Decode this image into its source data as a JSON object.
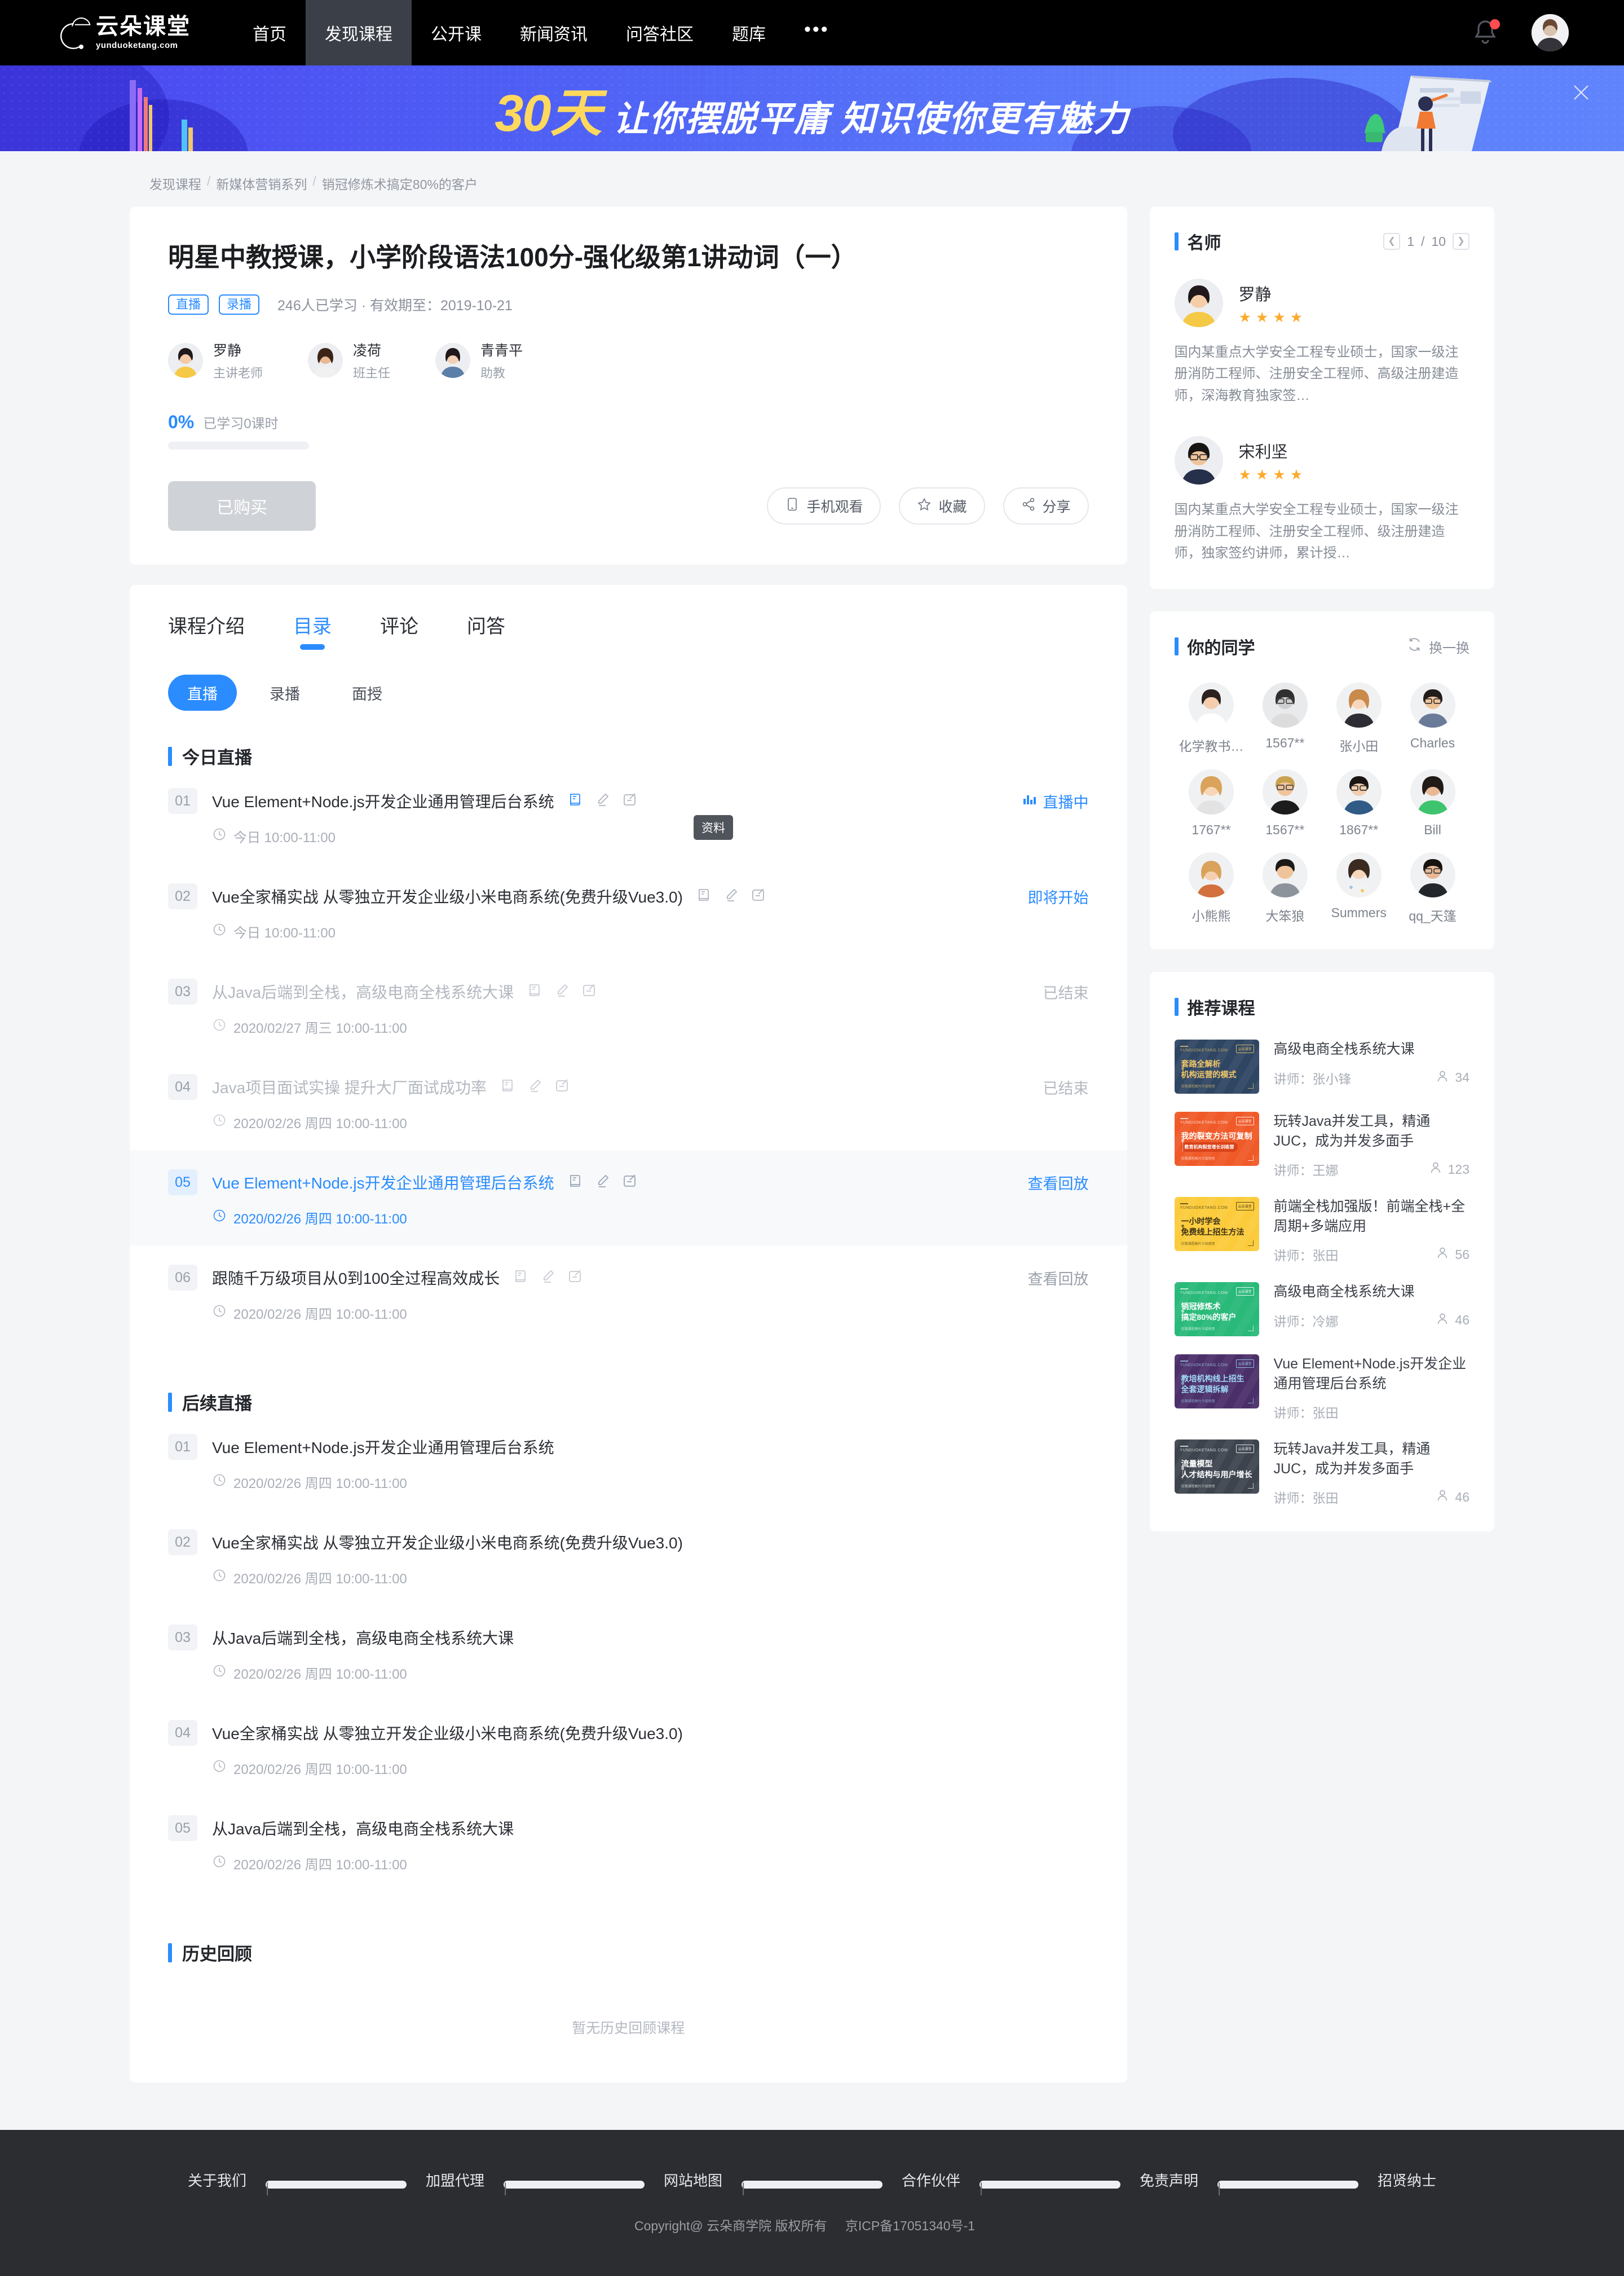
{
  "header": {
    "logo_name": "云朵课堂",
    "logo_domain": "yunduoketang.com",
    "nav": [
      {
        "label": "首页",
        "active": false
      },
      {
        "label": "发现课程",
        "active": true
      },
      {
        "label": "公开课",
        "active": false
      },
      {
        "label": "新闻资讯",
        "active": false
      },
      {
        "label": "问答社区",
        "active": false
      },
      {
        "label": "题库",
        "active": false
      }
    ],
    "more_label": "•••"
  },
  "banner": {
    "highlight": "30天",
    "text": "让你摆脱平庸  知识使你更有魅力"
  },
  "breadcrumb": {
    "items": [
      "发现课程",
      "新媒体营销系列",
      "销冠修炼术搞定80%的客户"
    ],
    "separator": "/"
  },
  "course": {
    "title": "明星中教授课，小学阶段语法100分-强化级第1讲动词（一）",
    "tags": [
      "直播",
      "录播"
    ],
    "meta": "246人已学习 · 有效期至：2019-10-21",
    "teachers": [
      {
        "name": "罗静",
        "role": "主讲老师"
      },
      {
        "name": "凌荷",
        "role": "班主任"
      },
      {
        "name": "青青平",
        "role": "助教"
      }
    ],
    "progress_pct": "0%",
    "progress_value": 0,
    "progress_label": "已学习0课时",
    "buy_button": "已购买",
    "actions": [
      {
        "label": "手机观看",
        "icon": "phone-icon"
      },
      {
        "label": "收藏",
        "icon": "star-icon"
      },
      {
        "label": "分享",
        "icon": "share-icon"
      }
    ]
  },
  "catalog": {
    "tabs": [
      {
        "label": "课程介绍",
        "active": false
      },
      {
        "label": "目录",
        "active": true
      },
      {
        "label": "评论",
        "active": false
      },
      {
        "label": "问答",
        "active": false
      }
    ],
    "subtabs": [
      {
        "label": "直播",
        "active": true
      },
      {
        "label": "录播",
        "active": false
      },
      {
        "label": "面授",
        "active": false
      }
    ],
    "tooltip": "资料",
    "sections": [
      {
        "title": "今日直播",
        "lessons": [
          {
            "num": "01",
            "title": "Vue Element+Node.js开发企业通用管理后台系统",
            "time": "今日 10:00-11:00",
            "status": "直播中",
            "state": "live",
            "icons": true
          },
          {
            "num": "02",
            "title": "Vue全家桶实战 从零独立开发企业级小米电商系统(免费升级Vue3.0)",
            "time": "今日 10:00-11:00",
            "status": "即将开始",
            "state": "soon",
            "icons": true
          },
          {
            "num": "03",
            "title": "从Java后端到全栈，高级电商全栈系统大课",
            "time": "2020/02/27 周三 10:00-11:00",
            "status": "已结束",
            "state": "ended",
            "icons": true
          },
          {
            "num": "04",
            "title": "Java项目面试实操 提升大厂面试成功率",
            "time": "2020/02/26 周四 10:00-11:00",
            "status": "已结束",
            "state": "ended",
            "icons": true
          },
          {
            "num": "05",
            "title": "Vue Element+Node.js开发企业通用管理后台系统",
            "time": "2020/02/26 周四 10:00-11:00",
            "status": "查看回放",
            "state": "highlight",
            "icons": true
          },
          {
            "num": "06",
            "title": "跟随千万级项目从0到100全过程高效成长",
            "time": "2020/02/26 周四 10:00-11:00",
            "status": "查看回放",
            "state": "replay",
            "icons": true
          }
        ]
      },
      {
        "title": "后续直播",
        "lessons": [
          {
            "num": "01",
            "title": "Vue Element+Node.js开发企业通用管理后台系统",
            "time": "2020/02/26 周四 10:00-11:00",
            "status": "",
            "state": "plain",
            "icons": false
          },
          {
            "num": "02",
            "title": "Vue全家桶实战 从零独立开发企业级小米电商系统(免费升级Vue3.0)",
            "time": "2020/02/26 周四 10:00-11:00",
            "status": "",
            "state": "plain",
            "icons": false
          },
          {
            "num": "03",
            "title": "从Java后端到全栈，高级电商全栈系统大课",
            "time": "2020/02/26 周四 10:00-11:00",
            "status": "",
            "state": "plain",
            "icons": false
          },
          {
            "num": "04",
            "title": "Vue全家桶实战 从零独立开发企业级小米电商系统(免费升级Vue3.0)",
            "time": "2020/02/26 周四 10:00-11:00",
            "status": "",
            "state": "plain",
            "icons": false
          },
          {
            "num": "05",
            "title": "从Java后端到全栈，高级电商全栈系统大课",
            "time": "2020/02/26 周四 10:00-11:00",
            "status": "",
            "state": "plain",
            "icons": false
          }
        ]
      },
      {
        "title": "历史回顾",
        "empty": "暂无历史回顾课程",
        "lessons": []
      }
    ]
  },
  "sidebar": {
    "teachers_panel": {
      "title": "名师",
      "page_current": "1",
      "page_sep": "/",
      "page_total": "10",
      "prev_icon": "chevron-left-icon",
      "next_icon": "chevron-right-icon",
      "items": [
        {
          "name": "罗静",
          "stars": 4,
          "desc": "国内某重点大学安全工程专业硕士，国家一级注册消防工程师、注册安全工程师、高级注册建造师，深海教育独家签…"
        },
        {
          "name": "宋利坚",
          "stars": 4,
          "desc": "国内某重点大学安全工程专业硕士，国家一级注册消防工程师、注册安全工程师、级注册建造师，独家签约讲师，累计授…"
        }
      ]
    },
    "classmates_panel": {
      "title": "你的同学",
      "refresh_label": "换一换",
      "items": [
        {
          "name": "化学教书…"
        },
        {
          "name": "1567**"
        },
        {
          "name": "张小田"
        },
        {
          "name": "Charles"
        },
        {
          "name": "1767**"
        },
        {
          "name": "1567**"
        },
        {
          "name": "1867**"
        },
        {
          "name": "Bill"
        },
        {
          "name": "小熊熊"
        },
        {
          "name": "大笨狼"
        },
        {
          "name": "Summers"
        },
        {
          "name": "qq_天篷"
        }
      ]
    },
    "recommend_panel": {
      "title": "推荐课程",
      "teacher_prefix": "讲师：",
      "items": [
        {
          "title": "高级电商全栈系统大课",
          "teacher": "张小锋",
          "count": "34",
          "thumb_color": "#2f4663",
          "thumb_line1": "套路全解析",
          "thumb_line2": "机构运营的模式",
          "thumb_title_color": "#f2c869",
          "thumb_foot": "仅限课程图片介绍使用"
        },
        {
          "title": "玩转Java并发工具，精通JUC，成为并发多面手",
          "teacher": "王娜",
          "count": "123",
          "thumb_color": "#f05a28",
          "thumb_line1": "我的裂变方法可复制",
          "thumb_line2": "教育机构裂变增长训练营",
          "thumb_title_color": "#ffffff",
          "thumb_foot": "仅限课程图片介绍使用"
        },
        {
          "title": "前端全栈加强版！前端全栈+全周期+多端应用",
          "teacher": "张田",
          "count": "56",
          "thumb_color": "#fbcb3b",
          "thumb_line1": "一小时学会",
          "thumb_line2": "免费线上招生方法",
          "thumb_title_color": "#3e3216",
          "thumb_foot": "仅限课程图片介绍使用"
        },
        {
          "title": "高级电商全栈系统大课",
          "teacher": "冷娜",
          "count": "46",
          "thumb_color": "#29b979",
          "thumb_line1": "销冠修炼术",
          "thumb_line2": "搞定80%的客户",
          "thumb_title_color": "#ffffff",
          "thumb_foot": "仅限课程图片介绍使用"
        },
        {
          "title": "Vue Element+Node.js开发企业通用管理后台系统",
          "teacher": "张田",
          "count": "",
          "thumb_color": "#4b2f69",
          "thumb_line1": "教培机构线上招生",
          "thumb_line2": "全套逻辑拆解",
          "thumb_title_color": "#9fd8f5",
          "thumb_foot": "仅限课程图片介绍使用"
        },
        {
          "title": "玩转Java并发工具，精通JUC，成为并发多面手",
          "teacher": "张田",
          "count": "46",
          "thumb_color": "#3d444e",
          "thumb_line1": "流量模型",
          "thumb_line2": "人才结构与用户增长",
          "thumb_title_color": "#ffffff",
          "thumb_foot": "仅限课程图片介绍使用"
        }
      ]
    }
  },
  "footer": {
    "links": [
      "关于我们",
      "加盟代理",
      "网站地图",
      "合作伙伴",
      "免责声明",
      "招贤纳士"
    ],
    "separator": "|",
    "copyright": "Copyright@ 云朵商学院  版权所有",
    "icp": "京ICP备17051340号-1"
  },
  "colors": {
    "accent": "#2a8cff",
    "header_bg": "#000000",
    "footer_bg": "#2b2d31",
    "page_bg": "#f4f5f7",
    "star": "#fcab2e"
  }
}
